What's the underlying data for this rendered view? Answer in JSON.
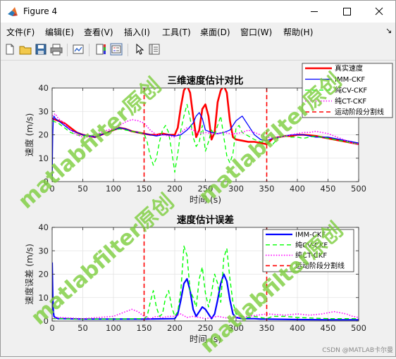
{
  "window": {
    "title": "Figure 4",
    "controls": [
      "minimize",
      "maximize",
      "close"
    ]
  },
  "menubar": {
    "items": [
      "文件(F)",
      "编辑(E)",
      "查看(V)",
      "插入(I)",
      "工具(T)",
      "桌面(D)",
      "窗口(W)",
      "帮助(H)"
    ],
    "overflow": "↘"
  },
  "toolbar": {
    "buttons": [
      "new-figure-icon",
      "open-icon",
      "save-icon",
      "print-icon",
      "link-plot-icon",
      "insert-colorbar-icon",
      "insert-legend-icon",
      "edit-plot-arrow-icon",
      "property-inspector-icon"
    ]
  },
  "watermark": "matlabfilter原创",
  "footer_credit": "CSDN @MATLAB卡尔曼",
  "colors": {
    "true": "#ff0000",
    "imm": "#0000ff",
    "cv": "#00ff00",
    "ct": "#ff00ff",
    "divider": "#ff0000",
    "watermark": "#7ccd3c"
  },
  "chart_data": [
    {
      "type": "line",
      "title": "三维速度估计对比",
      "xlabel": "时间 (s)",
      "ylabel": "速度 (m/s)",
      "xlim": [
        0,
        500
      ],
      "ylim": [
        0,
        40
      ],
      "xticks": [
        0,
        50,
        100,
        150,
        200,
        250,
        300,
        350,
        400,
        450,
        500
      ],
      "yticks": [
        0,
        10,
        20,
        30,
        40
      ],
      "grid": true,
      "legend_position": "top-right",
      "vlines": [
        150,
        350
      ],
      "series": [
        {
          "name": "真实速度",
          "style": "solid",
          "width": 2.6,
          "x": [
            0,
            5,
            10,
            20,
            30,
            40,
            50,
            60,
            70,
            80,
            90,
            100,
            110,
            120,
            130,
            140,
            150,
            160,
            170,
            180,
            190,
            200,
            205,
            210,
            215,
            220,
            225,
            230,
            235,
            240,
            245,
            250,
            255,
            260,
            265,
            270,
            275,
            280,
            285,
            290,
            295,
            300,
            310,
            320,
            330,
            340,
            350,
            360,
            370,
            380,
            390,
            400,
            410,
            420,
            430,
            440,
            450,
            460,
            470,
            480,
            490,
            500
          ],
          "y": [
            27,
            26.5,
            26,
            25,
            23,
            21,
            20,
            19.5,
            19,
            20,
            21,
            22,
            23,
            22.5,
            21.5,
            21,
            20.5,
            20,
            20,
            20.5,
            20,
            20,
            23,
            32,
            39,
            41,
            38,
            28,
            19,
            22,
            31,
            33,
            28,
            18,
            21,
            34,
            39,
            41,
            38,
            26,
            19,
            18,
            17.5,
            17,
            17,
            16.5,
            16,
            18.5,
            19,
            19.5,
            19.5,
            20,
            20,
            19.8,
            19.5,
            19,
            18.5,
            18,
            17.5,
            17,
            16.5,
            16
          ]
        },
        {
          "name": "IMM-CKF",
          "style": "solid",
          "width": 1.3,
          "x": [
            0,
            1,
            2,
            3,
            5,
            10,
            20,
            30,
            40,
            50,
            60,
            70,
            80,
            90,
            100,
            110,
            120,
            130,
            140,
            150,
            160,
            170,
            180,
            190,
            200,
            210,
            220,
            230,
            235,
            240,
            245,
            250,
            260,
            270,
            280,
            290,
            300,
            310,
            320,
            330,
            340,
            350,
            360,
            370,
            380,
            390,
            400,
            410,
            420,
            430,
            440,
            450,
            460,
            470,
            480,
            490,
            500
          ],
          "y": [
            0,
            20,
            27,
            28,
            27,
            26,
            24,
            22,
            21,
            20,
            19.5,
            19,
            20,
            21,
            22,
            23,
            22.5,
            21.5,
            21,
            20.5,
            20,
            19.5,
            20,
            20,
            19.5,
            20,
            22,
            25,
            28,
            29.5,
            27,
            22,
            21,
            20.5,
            21,
            22,
            26,
            28,
            24,
            20,
            18,
            17.5,
            18.5,
            19,
            19.5,
            20,
            20,
            20,
            19.5,
            19,
            19,
            19,
            18.5,
            18,
            17.5,
            17,
            16.5
          ]
        },
        {
          "name": "纯CV-CKF",
          "style": "dashed",
          "width": 1.3,
          "x": [
            0,
            10,
            20,
            30,
            40,
            50,
            60,
            70,
            80,
            90,
            100,
            110,
            120,
            130,
            140,
            150,
            155,
            160,
            165,
            170,
            175,
            180,
            185,
            190,
            195,
            200,
            205,
            210,
            215,
            220,
            225,
            230,
            235,
            240,
            245,
            250,
            255,
            260,
            265,
            270,
            275,
            280,
            285,
            290,
            295,
            300,
            305,
            310,
            320,
            330,
            340,
            350,
            360,
            370,
            380,
            390,
            400,
            410,
            420,
            430,
            440,
            450,
            460,
            470,
            480,
            490,
            500
          ],
          "y": [
            26,
            25,
            23,
            21,
            20,
            19.5,
            19.5,
            20,
            20.5,
            21,
            22,
            22.5,
            22,
            21.5,
            21,
            20.5,
            17,
            11,
            7,
            10,
            17,
            22,
            24,
            21,
            13,
            4,
            12,
            22,
            28,
            33,
            27,
            19,
            15,
            17,
            24,
            13,
            17,
            22,
            20,
            24,
            28,
            19,
            11,
            8,
            12,
            23,
            24,
            21,
            19.5,
            18,
            17,
            16.5,
            16,
            19,
            19.5,
            19,
            19,
            18.5,
            19,
            19.5,
            19,
            18.5,
            18,
            17.5,
            17,
            16.5,
            16
          ]
        },
        {
          "name": "纯CT-CKF",
          "style": "dotted",
          "width": 1.6,
          "x": [
            0,
            5,
            10,
            20,
            30,
            40,
            50,
            60,
            70,
            80,
            90,
            100,
            110,
            120,
            130,
            140,
            150,
            160,
            170,
            180,
            190,
            200,
            210,
            220,
            230,
            240,
            250,
            260,
            270,
            280,
            290,
            300,
            310,
            320,
            330,
            340,
            350,
            360,
            370,
            380,
            390,
            400,
            410,
            420,
            430,
            440,
            450,
            460,
            470,
            480,
            490,
            500
          ],
          "y": [
            28,
            29,
            27,
            25,
            22,
            20,
            19,
            19,
            20,
            21,
            22,
            22.5,
            24,
            25.5,
            26.5,
            26,
            25,
            22,
            20,
            20,
            19.5,
            19,
            21,
            23,
            22,
            20.5,
            21,
            20.5,
            20.5,
            21,
            20.5,
            20.5,
            21,
            22,
            21,
            20,
            19,
            18.5,
            19,
            19.5,
            20,
            20.5,
            21,
            21,
            21.5,
            21,
            20.5,
            19.5,
            18.5,
            17.5,
            16.5,
            16
          ]
        },
        {
          "name": "运动阶段分割线",
          "style": "dashed",
          "width": 1.6,
          "x": [],
          "y": []
        }
      ]
    },
    {
      "type": "line",
      "title": "速度估计误差",
      "xlabel": "时间 (s)",
      "ylabel": "速度误差 (m/s)",
      "xlim": [
        0,
        500
      ],
      "ylim": [
        0,
        40
      ],
      "xticks": [
        0,
        50,
        100,
        150,
        200,
        250,
        300,
        350,
        400,
        450,
        500
      ],
      "yticks": [
        0,
        10,
        20,
        30,
        40
      ],
      "grid": true,
      "legend_position": "top-right",
      "vlines": [
        150,
        350
      ],
      "series": [
        {
          "name": "IMM-CKF",
          "style": "solid",
          "width": 2.2,
          "x": [
            0,
            1,
            2,
            3,
            5,
            10,
            20,
            50,
            100,
            150,
            200,
            205,
            210,
            215,
            220,
            225,
            230,
            235,
            240,
            245,
            250,
            255,
            260,
            265,
            270,
            275,
            280,
            285,
            290,
            295,
            300,
            310,
            320,
            330,
            340,
            350,
            400,
            450,
            500
          ],
          "y": [
            25,
            10,
            4,
            2,
            1.5,
            1,
            1,
            0.8,
            0.8,
            0.8,
            1,
            3,
            9,
            16,
            18,
            13,
            5,
            2,
            4,
            6,
            5,
            3,
            1,
            3,
            9,
            16,
            20,
            17,
            9,
            3,
            1.5,
            1,
            1,
            1,
            0.8,
            0.8,
            0.6,
            0.5,
            0.5
          ]
        },
        {
          "name": "纯CV-CKF",
          "style": "dashed",
          "width": 1.4,
          "x": [
            0,
            10,
            50,
            100,
            150,
            155,
            160,
            165,
            170,
            175,
            180,
            185,
            190,
            195,
            200,
            205,
            210,
            215,
            220,
            225,
            230,
            235,
            240,
            245,
            250,
            255,
            260,
            265,
            270,
            275,
            280,
            285,
            290,
            295,
            300,
            310,
            320,
            330,
            340,
            350,
            360,
            380,
            400,
            450,
            500
          ],
          "y": [
            1,
            1,
            0.8,
            0.8,
            1,
            2,
            8,
            13,
            6,
            2,
            3,
            10,
            13,
            6,
            2,
            4,
            13,
            32,
            28,
            13,
            10,
            6,
            18,
            23,
            12,
            6,
            12,
            20,
            16,
            8,
            27,
            31,
            18,
            8,
            3,
            2,
            1.5,
            2,
            1.5,
            1,
            2,
            2,
            1.5,
            1,
            1
          ]
        },
        {
          "name": "纯CT-CKF",
          "style": "dotted",
          "width": 1.6,
          "x": [
            0,
            10,
            50,
            100,
            120,
            130,
            140,
            150,
            160,
            170,
            180,
            190,
            200,
            210,
            220,
            230,
            240,
            250,
            260,
            270,
            280,
            290,
            300,
            320,
            350,
            380,
            400,
            420,
            440,
            460,
            480,
            490,
            500
          ],
          "y": [
            1,
            1.5,
            1,
            2,
            4,
            5,
            4,
            2,
            1,
            2,
            1.5,
            2,
            2,
            3,
            1.5,
            2,
            1.5,
            1,
            1.5,
            2,
            1.5,
            1,
            1.5,
            2,
            3,
            2.5,
            3,
            2.5,
            3,
            4,
            3,
            2,
            1.5
          ]
        },
        {
          "name": "运动阶段分割线",
          "style": "dashed",
          "width": 1.6,
          "x": [],
          "y": []
        }
      ]
    }
  ]
}
